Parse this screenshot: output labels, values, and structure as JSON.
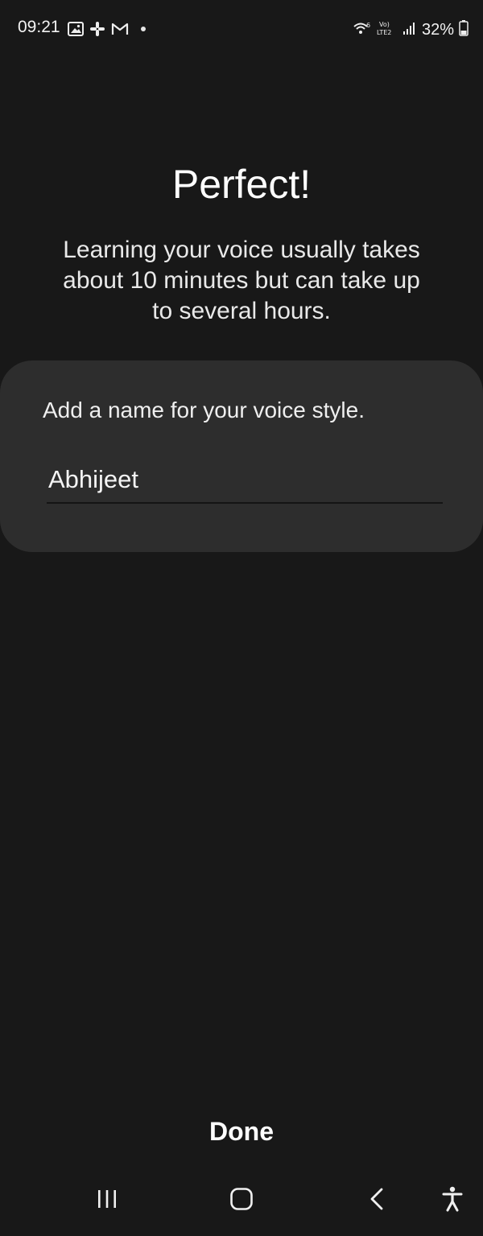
{
  "status_bar": {
    "time": "09:21",
    "battery": "32%",
    "left_icons": [
      "gallery-icon",
      "slack-icon",
      "gmail-icon",
      "notification-dot"
    ],
    "right_icons": [
      "wifi-6-icon",
      "volte-lte2-icon",
      "signal-icon",
      "battery-icon"
    ]
  },
  "header": {
    "title": "Perfect!",
    "description": "Learning your voice usually takes\nabout 10 minutes but can take up\nto several hours."
  },
  "card": {
    "prompt": "Add a name for your voice style.",
    "name_value": "Abhijeet"
  },
  "actions": {
    "done_label": "Done"
  },
  "nav": {
    "items": [
      "recents-icon",
      "home-icon",
      "back-icon",
      "accessibility-icon"
    ]
  },
  "colors": {
    "background": "#181818",
    "card": "#2d2d2d",
    "text": "#ffffff"
  }
}
